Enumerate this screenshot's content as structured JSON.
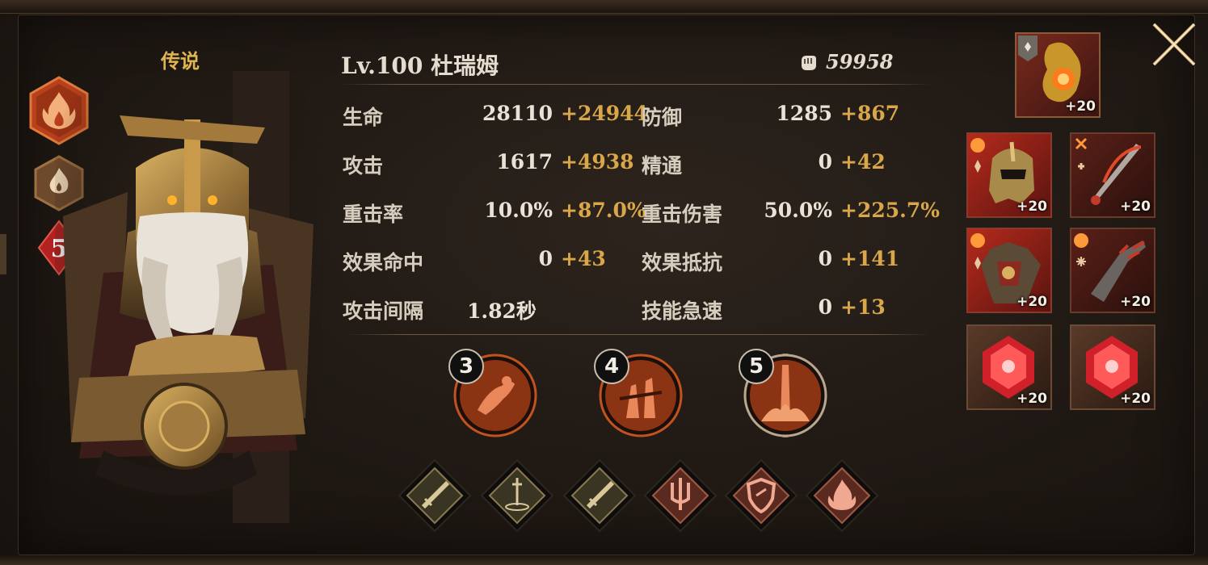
{
  "hero": {
    "rarity": "传说",
    "star_level": "5",
    "level_name": "Lv.100 杜瑞姆",
    "power": "59958"
  },
  "stats": [
    {
      "label": "生命",
      "base": "28110",
      "bonus": "+24944"
    },
    {
      "label": "防御",
      "base": "1285",
      "bonus": "+867"
    },
    {
      "label": "攻击",
      "base": "1617",
      "bonus": "+4938"
    },
    {
      "label": "精通",
      "base": "0",
      "bonus": "+42"
    },
    {
      "label": "重击率",
      "base": "10.0%",
      "bonus": "+87.0%"
    },
    {
      "label": "重击伤害",
      "base": "50.0%",
      "bonus": "+225.7%"
    },
    {
      "label": "效果命中",
      "base": "0",
      "bonus": "+43"
    },
    {
      "label": "效果抵抗",
      "base": "0",
      "bonus": "+141"
    },
    {
      "label": "攻击间隔",
      "base": "1.82秒",
      "bonus": ""
    },
    {
      "label": "技能急速",
      "base": "0",
      "bonus": "+13"
    }
  ],
  "skills": [
    {
      "level": "3",
      "icon": "figure-skill-icon"
    },
    {
      "level": "4",
      "icon": "shadows-skill-icon"
    },
    {
      "level": "5",
      "icon": "eruption-skill-icon"
    }
  ],
  "traits": [
    {
      "icon": "sword-icon",
      "tone": "gold"
    },
    {
      "icon": "sword-ground-icon",
      "tone": "gold"
    },
    {
      "icon": "sword-icon",
      "tone": "gold"
    },
    {
      "icon": "trident-icon",
      "tone": "red"
    },
    {
      "icon": "shield-icon",
      "tone": "red"
    },
    {
      "icon": "flame-icon",
      "tone": "red"
    }
  ],
  "equipment": [
    {
      "slot": "amulet",
      "plus": "+20"
    },
    {
      "slot": "helmet",
      "plus": "+20"
    },
    {
      "slot": "dagger",
      "plus": "+20"
    },
    {
      "slot": "armor",
      "plus": "+20"
    },
    {
      "slot": "gauntlet",
      "plus": "+20"
    },
    {
      "slot": "gem-left",
      "plus": "+20"
    },
    {
      "slot": "gem-right",
      "plus": "+20"
    }
  ],
  "colors": {
    "gold": "#d9a74a",
    "text": "#e4dccf",
    "fire": "#c04a22"
  }
}
